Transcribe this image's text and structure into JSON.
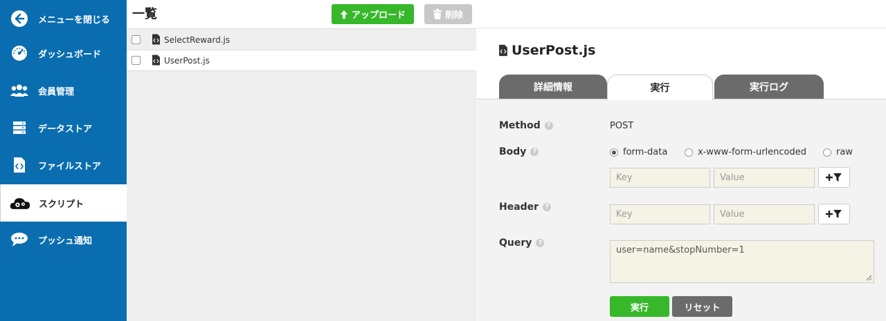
{
  "sidebar": {
    "items": [
      {
        "label": "メニューを閉じる",
        "icon": "arrow-left-circle-icon"
      },
      {
        "label": "ダッシュボード",
        "icon": "dashboard-gauge-icon"
      },
      {
        "label": "会員管理",
        "icon": "users-icon"
      },
      {
        "label": "データストア",
        "icon": "database-icon"
      },
      {
        "label": "ファイルストア",
        "icon": "file-code-icon"
      },
      {
        "label": "スクリプト",
        "icon": "cloud-gears-icon",
        "active": true
      },
      {
        "label": "プッシュ通知",
        "icon": "chat-bubble-icon"
      }
    ]
  },
  "list": {
    "title": "一覧",
    "upload_label": "アップロード",
    "delete_label": "削除",
    "files": [
      {
        "name": "SelectReward.js"
      },
      {
        "name": "UserPost.js"
      }
    ]
  },
  "detail": {
    "title": "UserPost.js",
    "tabs": [
      {
        "label": "詳細情報"
      },
      {
        "label": "実行",
        "active": true
      },
      {
        "label": "実行ログ"
      }
    ],
    "method_label": "Method",
    "method_value": "POST",
    "body_label": "Body",
    "body_options": [
      {
        "label": "form-data",
        "selected": true
      },
      {
        "label": "x-www-form-urlencoded"
      },
      {
        "label": "raw"
      }
    ],
    "body_key_placeholder": "Key",
    "body_value_placeholder": "Value",
    "header_label": "Header",
    "header_key_placeholder": "Key",
    "header_value_placeholder": "Value",
    "query_label": "Query",
    "query_value": "user=name&stopNumber=1",
    "run_label": "実行",
    "reset_label": "リセット"
  },
  "colors": {
    "sidebar_bg": "#0a6db0",
    "green_button": "#36b82a",
    "gray_button": "#6b6b6b",
    "input_bg": "#f5f3e5"
  }
}
